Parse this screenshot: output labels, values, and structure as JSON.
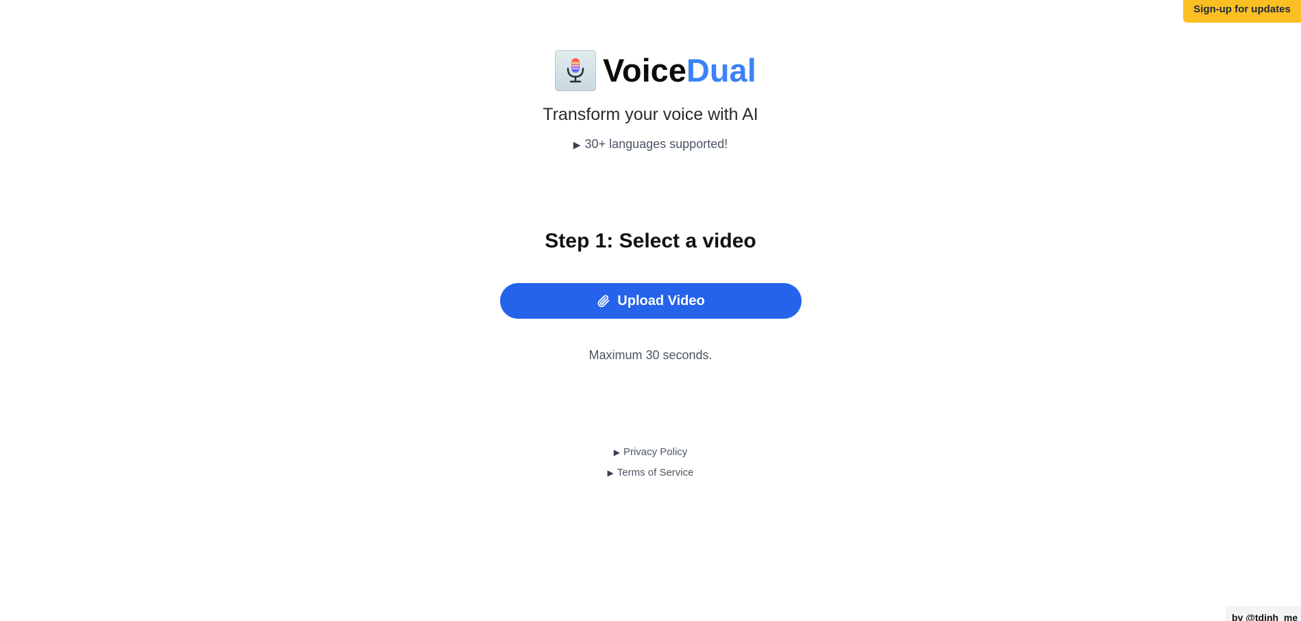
{
  "header": {
    "signup_label": "Sign-up for updates"
  },
  "brand": {
    "name_part1": "Voice",
    "name_part2": "Dual",
    "logo_icon": "microphone-icon",
    "accent_color": "#3b82f6"
  },
  "hero": {
    "tagline": "Transform your voice with AI",
    "languages_label": "30+ languages supported!"
  },
  "step": {
    "title": "Step 1: Select a video",
    "upload_label": "Upload Video",
    "upload_icon": "paperclip-icon",
    "limit_text": "Maximum 30 seconds."
  },
  "footer": {
    "privacy_label": "Privacy Policy",
    "terms_label": "Terms of Service",
    "credit_label": "by @tdinh_me"
  },
  "colors": {
    "primary_button": "#2563eb",
    "signup_button": "#fbbf24"
  }
}
